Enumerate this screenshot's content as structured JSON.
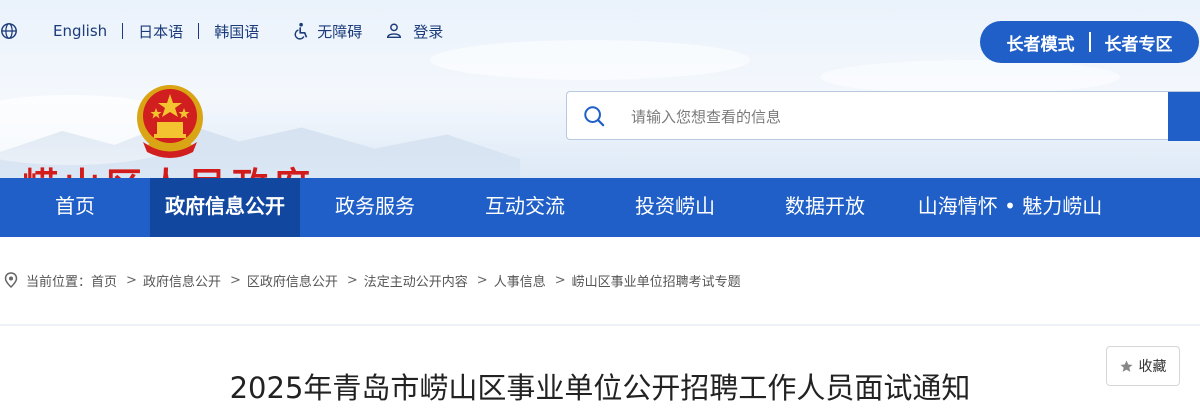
{
  "top_links": {
    "english": "English",
    "japanese": "日本语",
    "korean": "韩国语",
    "accessibility": "无障碍",
    "login": "登录"
  },
  "elder": {
    "mode": "长者模式",
    "zone": "长者专区"
  },
  "site": {
    "title": "崂山区人民政府"
  },
  "search": {
    "placeholder": "请输入您想查看的信息"
  },
  "nav": {
    "items": [
      {
        "label": "首页"
      },
      {
        "label": "政府信息公开"
      },
      {
        "label": "政务服务"
      },
      {
        "label": "互动交流"
      },
      {
        "label": "投资崂山"
      },
      {
        "label": "数据开放"
      },
      {
        "label": "山海情怀 • 魅力崂山"
      }
    ],
    "active_index": 1
  },
  "breadcrumb": {
    "prefix": "当前位置：",
    "items": [
      "首页",
      "政府信息公开",
      "区政府信息公开",
      "法定主动公开内容",
      "人事信息",
      "崂山区事业单位招聘考试专题"
    ]
  },
  "favorite": {
    "label": "收藏"
  },
  "article": {
    "title": "2025年青岛市崂山区事业单位公开招聘工作人员面试通知"
  },
  "colors": {
    "primary": "#1f5fc7",
    "nav_active": "#12479f",
    "title_red": "#d21c1c",
    "link_dark": "#1b3b7a"
  },
  "icons": [
    "globe-icon",
    "accessibility-icon",
    "user-icon",
    "search-icon",
    "location-pin-icon",
    "star-icon",
    "national-emblem-icon"
  ]
}
